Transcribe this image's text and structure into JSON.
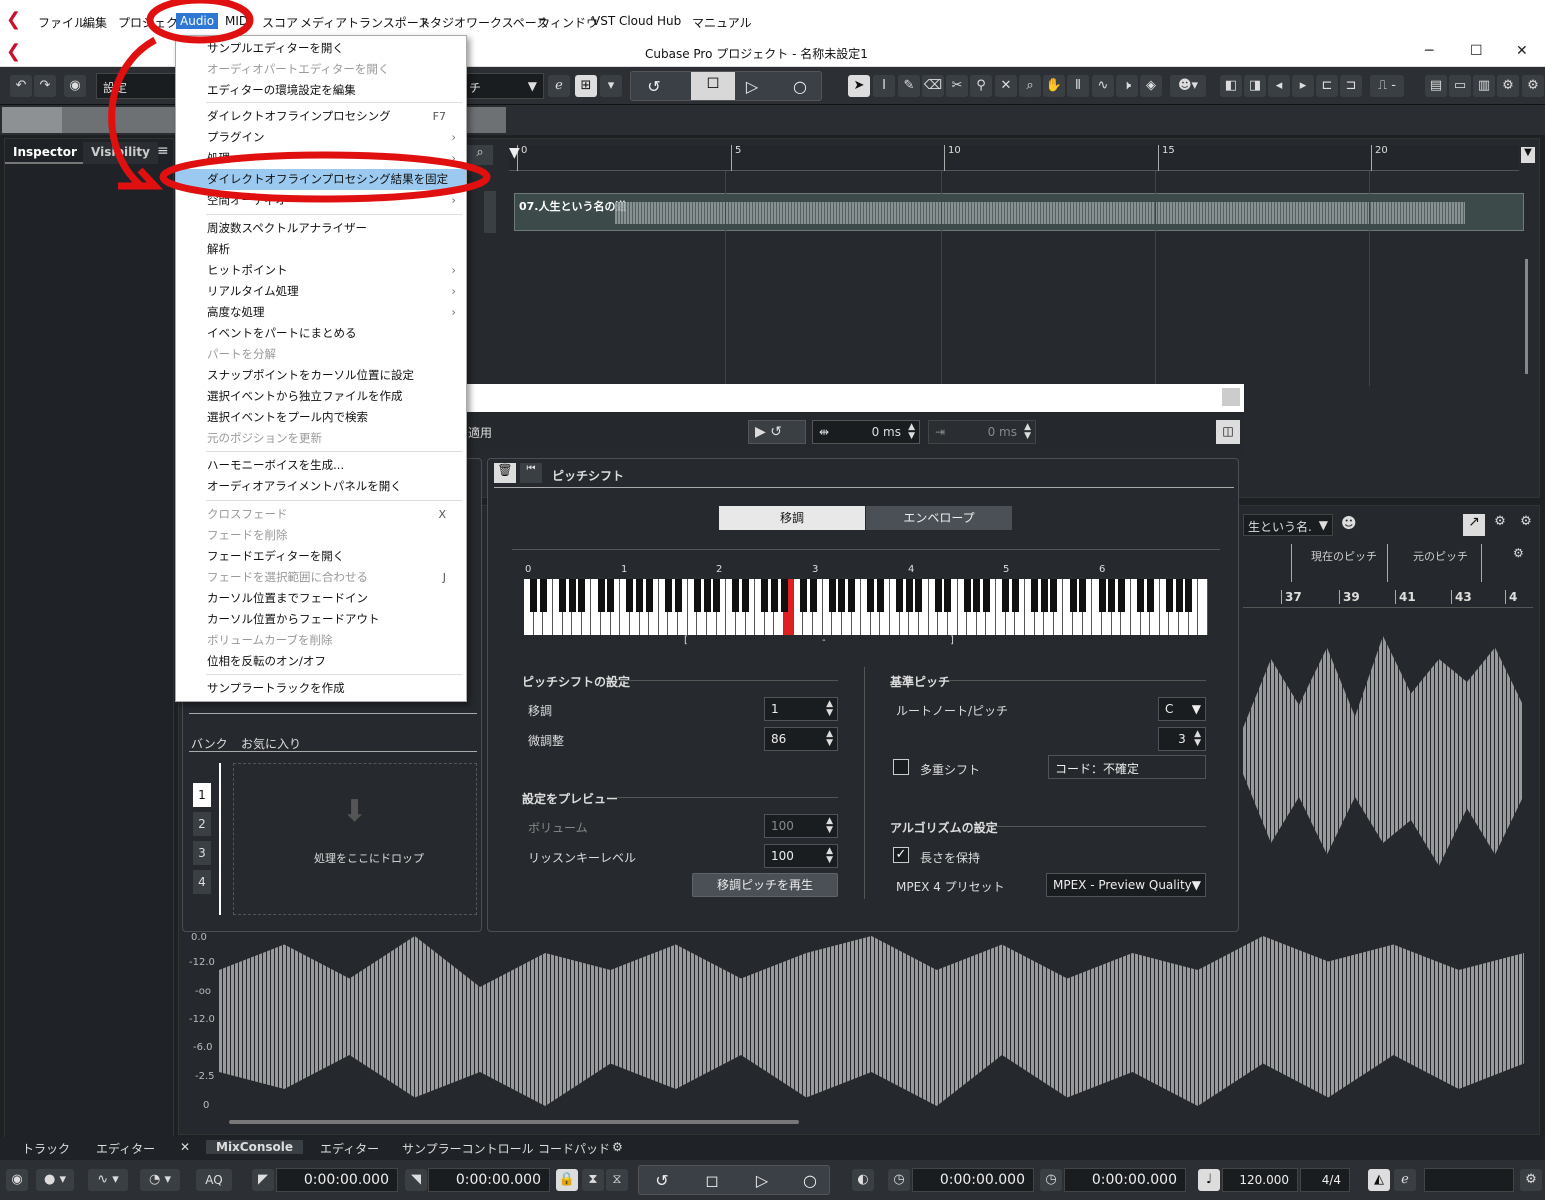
{
  "menubar": {
    "items": [
      "ファイル",
      "編集",
      "プロジェクト",
      "Audio",
      "MIDI",
      "スコア",
      "メディア",
      "トランスポート",
      "スタジオ",
      "ワークスペース",
      "ウィンドウ",
      "VST Cloud",
      "Hub",
      "マニュアル"
    ],
    "active": "Audio"
  },
  "window": {
    "title": "Cubase Pro プロジェクト - 名称未設定1",
    "minimize": "─",
    "maximize": "☐",
    "close": "✕"
  },
  "toolbar": {
    "preset_label": "設定",
    "pitch_label": "チ"
  },
  "inspector": {
    "tabs": [
      "Inspector",
      "Visibility"
    ]
  },
  "ruler": {
    "marks": [
      "0",
      "5",
      "10",
      "15",
      "20"
    ]
  },
  "clip": {
    "name": "07.人生という名の道"
  },
  "audio_menu": {
    "items": [
      {
        "label": "サンプルエディターを開く",
        "enabled": true
      },
      {
        "label": "オーディオパートエディターを開く",
        "enabled": false
      },
      {
        "label": "エディターの環境設定を編集",
        "enabled": true
      },
      {
        "label": "ダイレクトオフラインプロセシング",
        "enabled": true,
        "shortcut": "F7"
      },
      {
        "label": "プラグイン",
        "enabled": true,
        "submenu": true
      },
      {
        "label": "処理",
        "enabled": true,
        "submenu": true
      },
      {
        "label": "ダイレクトオフラインプロセシング結果を固定",
        "enabled": true,
        "highlighted": true
      },
      {
        "label": "空間オーディオ",
        "enabled": true,
        "submenu": true
      },
      {
        "label": "周波数スペクトルアナライザー",
        "enabled": true
      },
      {
        "label": "解析",
        "enabled": true
      },
      {
        "label": "ヒットポイント",
        "enabled": true,
        "submenu": true
      },
      {
        "label": "リアルタイム処理",
        "enabled": true,
        "submenu": true
      },
      {
        "label": "高度な処理",
        "enabled": true,
        "submenu": true
      },
      {
        "label": "イベントをパートにまとめる",
        "enabled": true
      },
      {
        "label": "パートを分解",
        "enabled": false
      },
      {
        "label": "スナップポイントをカーソル位置に設定",
        "enabled": true
      },
      {
        "label": "選択イベントから独立ファイルを作成",
        "enabled": true
      },
      {
        "label": "選択イベントをプール内で検索",
        "enabled": true
      },
      {
        "label": "元のポジションを更新",
        "enabled": false
      },
      {
        "label": "ハーモニーボイスを生成...",
        "enabled": true
      },
      {
        "label": "オーディオアライメントパネルを開く",
        "enabled": true
      },
      {
        "label": "クロスフェード",
        "enabled": false,
        "shortcut": "X"
      },
      {
        "label": "フェードを削除",
        "enabled": false
      },
      {
        "label": "フェードエディターを開く",
        "enabled": true
      },
      {
        "label": "フェードを選択範囲に合わせる",
        "enabled": false,
        "shortcut": "J"
      },
      {
        "label": "カーソル位置までフェードイン",
        "enabled": true
      },
      {
        "label": "カーソル位置からフェードアウト",
        "enabled": true
      },
      {
        "label": "ボリュームカーブを削除",
        "enabled": false
      },
      {
        "label": "位相を反転のオン/オフ",
        "enabled": true
      },
      {
        "label": "サンプラートラックを作成",
        "enabled": true
      }
    ]
  },
  "dialog": {
    "apply_label": "適用",
    "pre_ms": "0 ms",
    "post_ms": "0 ms"
  },
  "left_panel": {
    "bank_label": "バンク",
    "favorites_label": "お気に入り",
    "slots": [
      "1",
      "2",
      "3",
      "4"
    ],
    "drop_label": "処理をここにドロップ"
  },
  "pitch": {
    "title": "ピッチシフト",
    "tabs": [
      "移調",
      "エンベロープ"
    ],
    "octaves": [
      "0",
      "1",
      "2",
      "3",
      "4",
      "5",
      "6"
    ],
    "range_left": "[",
    "range_mid": "-",
    "range_right": "]",
    "settings_title": "ピッチシフトの設定",
    "transpose_label": "移調",
    "transpose_value": "1",
    "fine_label": "微調整",
    "fine_value": "86",
    "preview_title": "設定をプレビュー",
    "volume_label": "ボリューム",
    "volume_value": "100",
    "listen_label": "リッスンキーレベル",
    "listen_value": "100",
    "play_button": "移調ピッチを再生",
    "base_title": "基準ピッチ",
    "root_label": "ルートノート/ピッチ",
    "root_note": "C",
    "root_octave": "3",
    "multi_label": "多重シフト",
    "chord_label": "コード：不確定",
    "algo_title": "アルゴリズムの設定",
    "keep_length_label": "長さを保持",
    "mpex_label": "MPEX 4 プリセット",
    "mpex_value": "MPEX - Preview Quality"
  },
  "editor": {
    "dropdown": "生という名.",
    "current_pitch": "現在のピッチ",
    "original_pitch": "元のピッチ",
    "bar_nums": [
      "37",
      "39",
      "41",
      "43",
      "4"
    ],
    "db_labels": [
      "0.0",
      "-12.0",
      "-oo",
      "-12.0",
      "-6.0",
      "-2.5",
      "0"
    ]
  },
  "bottom_tabs": [
    "トラック",
    "エディター",
    "MixConsole",
    "エディター",
    "サンプラーコントロール",
    "コードパッド"
  ],
  "status": {
    "time1": "0:00:00.000",
    "time2": "0:00:00.000",
    "time3": "0:00:00.000",
    "time4": "0:00:00.000",
    "tempo": "120.000",
    "signature": "4/4",
    "aq": "AQ"
  }
}
